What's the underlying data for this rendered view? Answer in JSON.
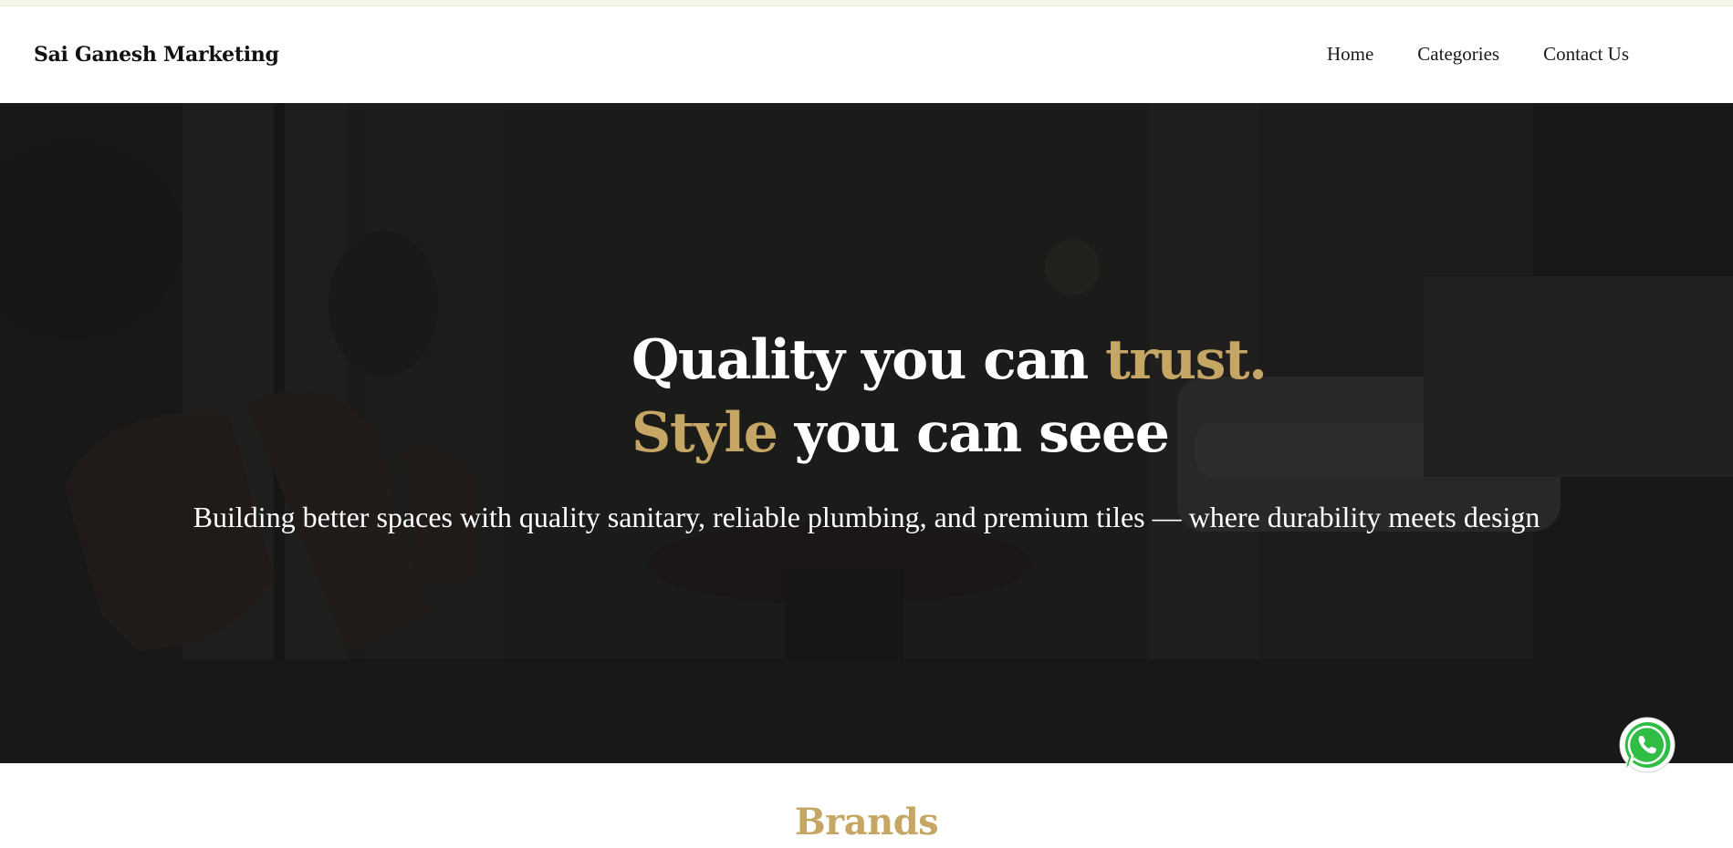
{
  "header": {
    "brand": "Sai Ganesh Marketing",
    "nav": [
      {
        "label": "Home"
      },
      {
        "label": "Categories"
      },
      {
        "label": "Contact Us"
      }
    ]
  },
  "hero": {
    "line1_white": "Quality you can",
    "line1_gold": "trust.",
    "line2_gold": "Style",
    "line2_white": "you can seee",
    "subtitle": "Building better spaces with quality sanitary, reliable plumbing, and premium tiles — where durability meets design"
  },
  "brands": {
    "title": "Brands"
  },
  "floating": {
    "whatsapp_icon": "whatsapp-icon"
  },
  "colors": {
    "accent_gold": "#c6a664",
    "hero_overlay": "#1f1e1c",
    "whatsapp_green": "#2fbd45"
  }
}
